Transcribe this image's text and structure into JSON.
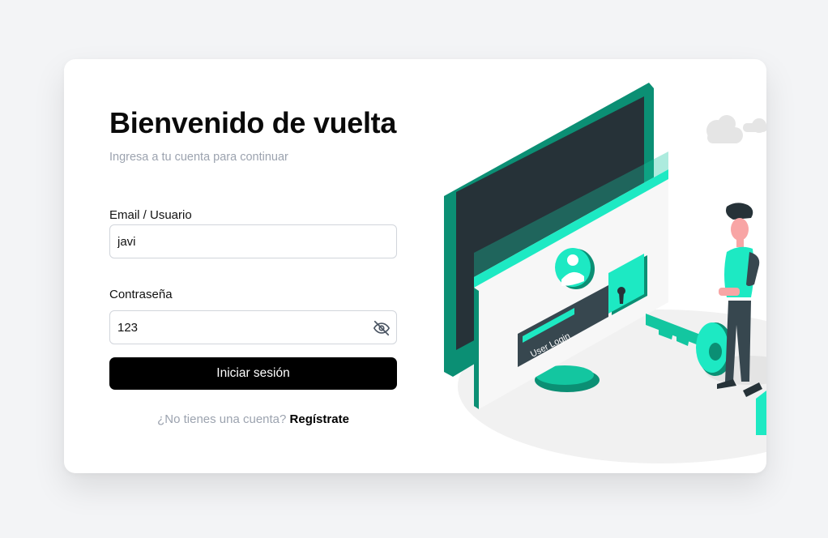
{
  "login": {
    "title": "Bienvenido de vuelta",
    "subtitle": "Ingresa a tu cuenta para continuar",
    "email_label": "Email / Usuario",
    "email_value": "javi",
    "password_label": "Contraseña",
    "password_value": "123",
    "submit_label": "Iniciar sesión",
    "signup_prompt": "¿No tienes una cuenta?",
    "signup_link": "Regístrate"
  },
  "illustration": {
    "screen_text": "User Login"
  },
  "colors": {
    "accent": "#1de9c3",
    "accent_dark": "#0b8f74",
    "button": "#000000",
    "muted_text": "#9ca3af"
  },
  "icons": {
    "password_toggle": "eye-slash-icon"
  }
}
